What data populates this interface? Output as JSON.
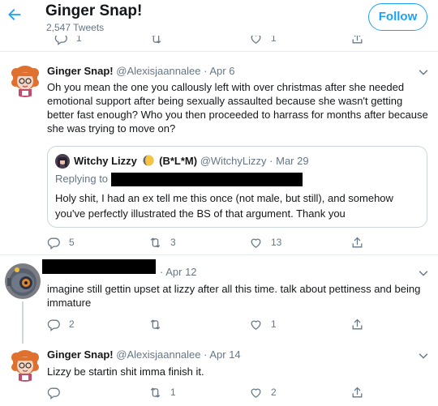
{
  "header": {
    "title": "Ginger Snap!",
    "tweet_count": "2,547 Tweets",
    "follow_label": "Follow"
  },
  "top_actions": {
    "reply": "1",
    "retweet": "",
    "like": "1"
  },
  "tweets": [
    {
      "name": "Ginger Snap!",
      "handle": "@Alexisjaannalee",
      "date": "· Apr 6",
      "text": "Oh you mean the one you callously left with over christmas after she needed emotional support after being sexually assaulted because she wasn't getting better fast enough? Who you then proceeded to harrass for months after because she was trying to move on?",
      "quote": {
        "name": "Witchy Lizzy",
        "suffix": "(B*L*M)",
        "handle": "@WitchyLizzy",
        "date": "· Mar 29",
        "replying": "Replying to",
        "text": "Holy shit, I had an ex tell me this once (not male, but still), and somehow you've perfectly illustrated the BS of that argument. Thank you"
      },
      "actions": {
        "reply": "5",
        "retweet": "3",
        "like": "13"
      }
    },
    {
      "date": "· Apr 12",
      "text": "imagine still gettin upset at lizzy after all this time. talk about pettiness and being immature",
      "actions": {
        "reply": "2",
        "retweet": "",
        "like": "1"
      }
    },
    {
      "name": "Ginger Snap!",
      "handle": "@Alexisjaannalee",
      "date": "· Apr 14",
      "text": "Lizzy be startin shit imma finish it.",
      "actions": {
        "reply": "",
        "retweet": "1",
        "like": "2"
      }
    }
  ],
  "icons": {
    "back": "arrow-left-icon",
    "reply": "reply-icon",
    "retweet": "retweet-icon",
    "like": "heart-icon",
    "share": "share-icon",
    "more": "chevron-down-icon",
    "moon": "moon-emoji"
  },
  "colors": {
    "accent": "#1da1f2",
    "muted": "#657786",
    "border": "#e6ecf0"
  }
}
